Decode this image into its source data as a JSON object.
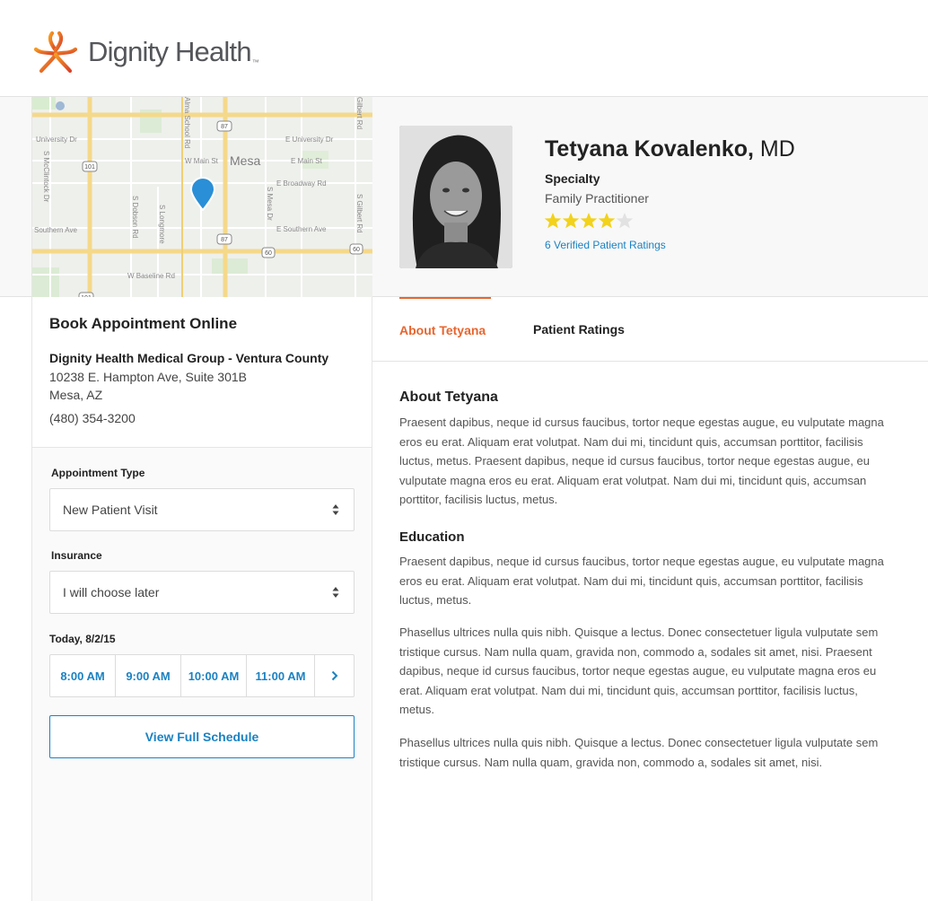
{
  "header": {
    "brand_name": "Dignity Health",
    "brand_mark": "™"
  },
  "map": {
    "city_label": "Mesa",
    "streets": [
      "University Dr",
      "E University Dr",
      "W Main St",
      "E Main St",
      "E Broadway Rd",
      "Southern Ave",
      "E Southern Ave",
      "W Baseline Rd",
      "S McClintock Dr",
      "S Dobson Rd",
      "S Longmore",
      "S Alma School Rd",
      "S Mesa Dr",
      "S Gilbert Rd",
      "Alma School Rd",
      "Gilbert Rd"
    ],
    "shields": [
      "87",
      "101",
      "87",
      "60",
      "60",
      "101"
    ]
  },
  "booking": {
    "title": "Book Appointment Online",
    "clinic_name": "Dignity Health Medical Group - Ventura County",
    "address_line1": "10238 E. Hampton Ave, Suite 301B",
    "address_line2": "Mesa, AZ",
    "phone": "(480) 354-3200",
    "appointment_type_label": "Appointment Type",
    "appointment_type_value": "New Patient Visit",
    "insurance_label": "Insurance",
    "insurance_value": "I will choose later",
    "date_label": "Today, 8/2/15",
    "slots": [
      "8:00 AM",
      "9:00 AM",
      "10:00 AM",
      "11:00 AM"
    ],
    "view_schedule_label": "View Full Schedule"
  },
  "doctor": {
    "name": "Tetyana Kovalenko,",
    "credential": "MD",
    "specialty_label": "Specialty",
    "specialty": "Family Practitioner",
    "rating": 4,
    "rating_max": 5,
    "ratings_link": "6 Verified Patient Ratings"
  },
  "tabs": {
    "about": "About Tetyana",
    "ratings": "Patient Ratings"
  },
  "content": {
    "about_title": "About Tetyana",
    "about_text": "Praesent dapibus, neque id cursus faucibus, tortor neque egestas augue, eu vulputate magna eros eu erat. Aliquam erat volutpat. Nam dui mi, tincidunt quis, accumsan porttitor, facilisis luctus, metus. Praesent dapibus, neque id cursus faucibus, tortor neque egestas augue, eu vulputate magna eros eu erat. Aliquam erat volutpat. Nam dui mi, tincidunt quis, accumsan porttitor, facilisis luctus, metus.",
    "education_title": "Education",
    "education_p1": "Praesent dapibus, neque id cursus faucibus, tortor neque egestas augue, eu vulputate magna eros eu erat. Aliquam erat volutpat. Nam dui mi, tincidunt quis, accumsan porttitor, facilisis luctus, metus.",
    "education_p2": "Phasellus ultrices nulla quis nibh. Quisque a lectus. Donec consectetuer ligula vulputate sem tristique cursus. Nam nulla quam, gravida non, commodo a, sodales sit amet, nisi. Praesent dapibus, neque id cursus faucibus, tortor neque egestas augue, eu vulputate magna eros eu erat. Aliquam erat volutpat. Nam dui mi, tincidunt quis, accumsan porttitor, facilisis luctus, metus.",
    "education_p3": "Phasellus ultrices nulla quis nibh. Quisque a lectus. Donec consectetuer ligula vulputate sem tristique cursus. Nam nulla quam, gravida non, commodo a, sodales sit amet, nisi."
  },
  "colors": {
    "accent_orange": "#e8652e",
    "link_blue": "#1a82c3",
    "star_yellow": "#f2d21b",
    "map_pin": "#2a8fd6"
  }
}
